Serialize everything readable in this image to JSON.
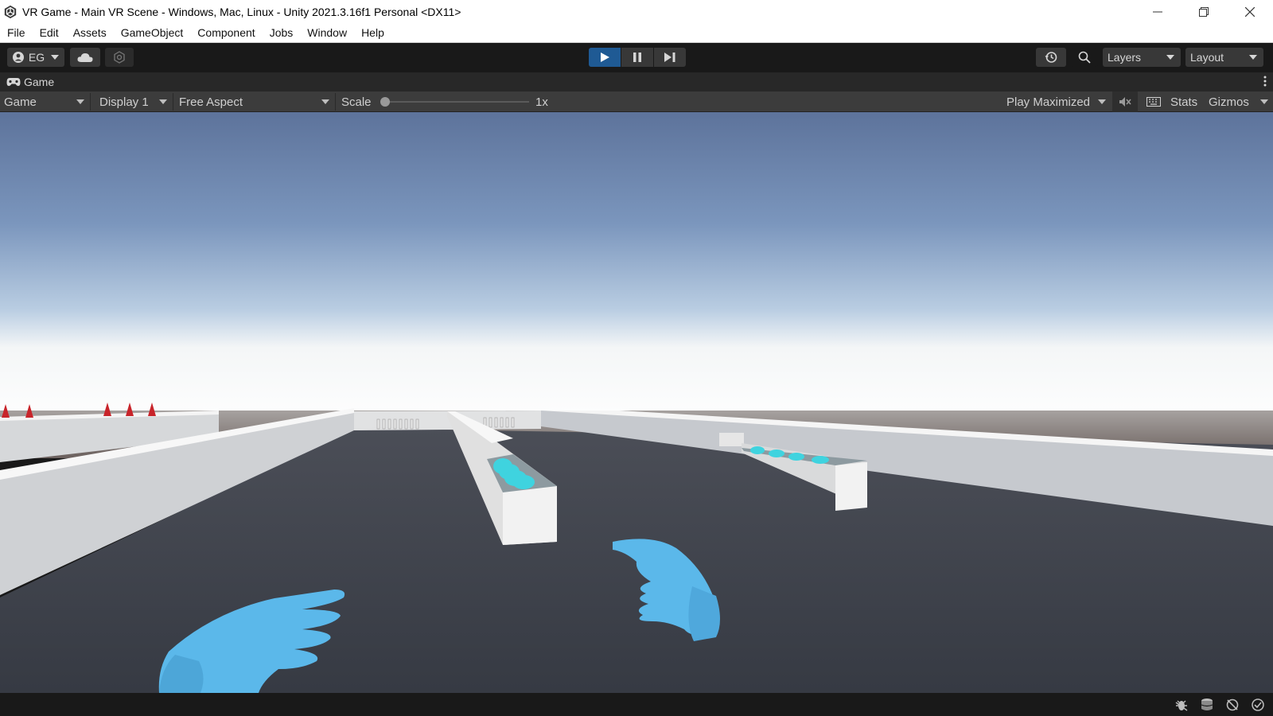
{
  "window": {
    "title": "VR Game - Main VR Scene - Windows, Mac, Linux - Unity 2021.3.16f1 Personal <DX11>"
  },
  "menu": [
    "File",
    "Edit",
    "Assets",
    "GameObject",
    "Component",
    "Jobs",
    "Window",
    "Help"
  ],
  "toolbar": {
    "account_label": "EG",
    "layers_label": "Layers",
    "layout_label": "Layout"
  },
  "tab": {
    "label": "Game"
  },
  "game_toolbar": {
    "view_mode": "Game",
    "display": "Display 1",
    "aspect": "Free Aspect",
    "scale_label": "Scale",
    "scale_value": "1x",
    "play_mode": "Play Maximized",
    "stats_label": "Stats",
    "gizmos_label": "Gizmos"
  },
  "colors": {
    "play_active": "#1f5a94",
    "hand_blue": "#5bb8ea",
    "ball_cyan": "#3fd3df"
  },
  "icons": {
    "unity_logo": "unity-icon",
    "account": "user-icon",
    "cloud": "cloud-icon",
    "collab": "collab-icon",
    "play": "play-icon",
    "pause": "pause-icon",
    "step": "step-icon",
    "history": "history-icon",
    "search": "search-icon",
    "mute": "mute-audio-icon",
    "shortcuts": "keyboard-icon"
  }
}
